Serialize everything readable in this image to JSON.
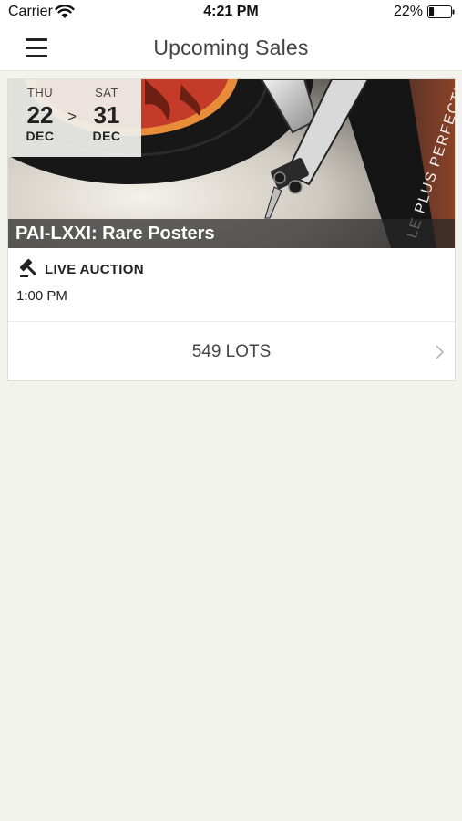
{
  "status_bar": {
    "carrier": "Carrier",
    "time": "4:21 PM",
    "battery_percent": "22%",
    "battery_level": 0.22
  },
  "nav": {
    "title": "Upcoming Sales",
    "menu_icon": "hamburger-menu-icon"
  },
  "sale": {
    "start": {
      "dow": "THU",
      "day": "22",
      "month": "DEC"
    },
    "separator": ">",
    "end": {
      "dow": "SAT",
      "day": "31",
      "month": "DEC"
    },
    "title": "PAI-LXXI: Rare Posters",
    "poster_text": "LE PLUS PERFECTION",
    "auction_icon": "gavel-icon",
    "auction_type": "LIVE AUCTION",
    "time": "1:00 PM",
    "lots": "549 LOTS"
  },
  "colors": {
    "background": "#f3f3ee",
    "record_red": "#c53b2a",
    "accent_orange": "#e88c3a"
  }
}
